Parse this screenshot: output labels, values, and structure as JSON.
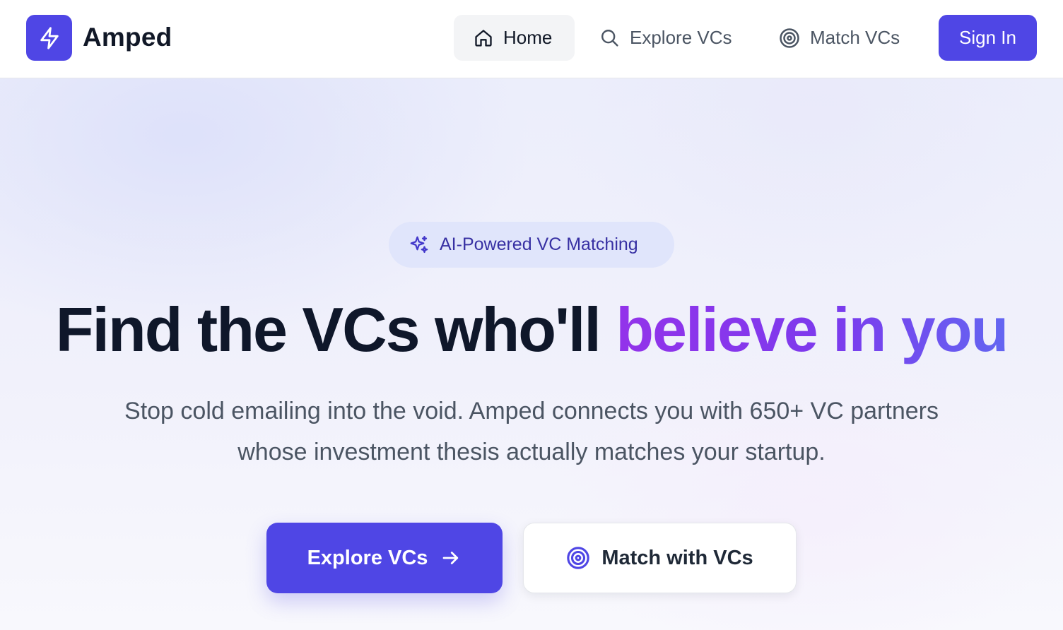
{
  "brand": {
    "name": "Amped",
    "logo_icon": "lightning-bolt-icon"
  },
  "nav": {
    "items": [
      {
        "label": "Home",
        "icon": "home-icon",
        "active": true
      },
      {
        "label": "Explore VCs",
        "icon": "search-icon",
        "active": false
      },
      {
        "label": "Match VCs",
        "icon": "target-icon",
        "active": false
      }
    ],
    "signin_label": "Sign In"
  },
  "hero": {
    "badge": {
      "label": "AI-Powered VC Matching",
      "icon": "sparkles-icon"
    },
    "headline_main": "Find the VCs who'll ",
    "headline_accent": "believe in you",
    "subtext": "Stop cold emailing into the void. Amped connects you with 650+ VC partners whose investment thesis actually matches your startup.",
    "primary_cta": {
      "label": "Explore VCs",
      "icon": "arrow-right-icon"
    },
    "secondary_cta": {
      "label": "Match with VCs",
      "icon": "target-icon"
    }
  },
  "colors": {
    "accent": "#4f46e5",
    "headline_gradient_start": "#9333ea",
    "headline_gradient_end": "#6366f1",
    "headline_text": "#0f172a",
    "body_text": "#4b5563"
  }
}
